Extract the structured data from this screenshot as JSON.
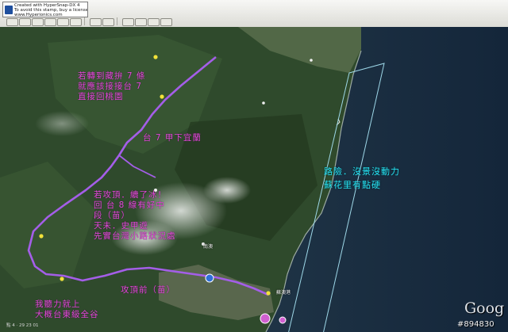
{
  "screenshot_badge": {
    "line1": "Created with HyperSnap-DX 4",
    "line2": "To avoid this stamp, buy a license at",
    "line3": "www.Hyperionics.com"
  },
  "notes": {
    "top": [
      "若轉到藏拚 7 條",
      "就應該接接台 7",
      "直接回桃園"
    ],
    "mid": "台 7 甲下宜蘭",
    "right": [
      "路險．沒景沒動力",
      "蘇花里有點硬"
    ],
    "center": [
      "若攻頂．續了冰！",
      "回 台 8 線有好中",
      "段（苗）",
      "天未．史甲遊",
      "先實台灣小路狀況處"
    ],
    "bottom_mid": "攻頂前（苗）",
    "bottom_left": [
      "我聽力就上",
      "大概台東級全谷"
    ]
  },
  "place_tags": {
    "town_a": "南澳",
    "town_b": "蘇澳港"
  },
  "status_bar": {
    "coords": "點 4 · 29 23 01"
  },
  "google_logo": "Goog",
  "watermark": "#894830",
  "colors": {
    "route": "#a45ee8",
    "note_magenta": "#e24cd8",
    "note_cyan": "#27e0f0",
    "box_cyan": "#9ed8e8"
  }
}
